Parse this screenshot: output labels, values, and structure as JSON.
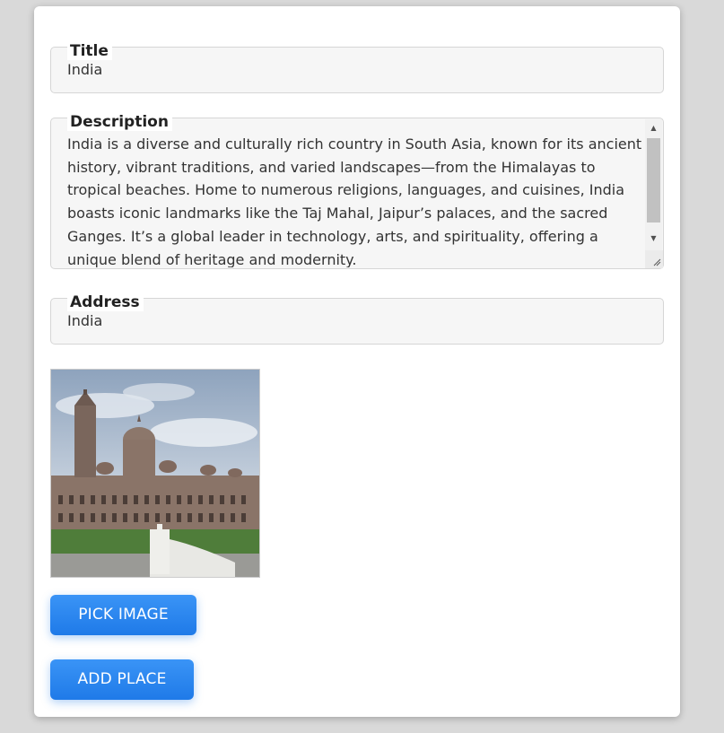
{
  "form": {
    "title": {
      "label": "Title",
      "value": "India"
    },
    "description": {
      "label": "Description",
      "value": "India is a diverse and culturally rich country in South Asia, known for its ancient history, vibrant traditions, and varied landscapes—from the Himalayas to tropical beaches. Home to numerous religions, languages, and cuisines, India boasts iconic landmarks like the Taj Mahal, Jaipur’s palaces, and the sacred Ganges. It’s a global leader in technology, arts, and spirituality, offering a unique blend of heritage and modernity."
    },
    "address": {
      "label": "Address",
      "value": "India"
    },
    "preview_image": {
      "icon": "palace-photo"
    },
    "pick_image_label": "PICK IMAGE",
    "add_place_label": "ADD PLACE"
  },
  "colors": {
    "accent": "#2684ef",
    "page_bg": "#d9d9d9",
    "card_bg": "#ffffff",
    "field_bg": "#f6f6f6"
  }
}
